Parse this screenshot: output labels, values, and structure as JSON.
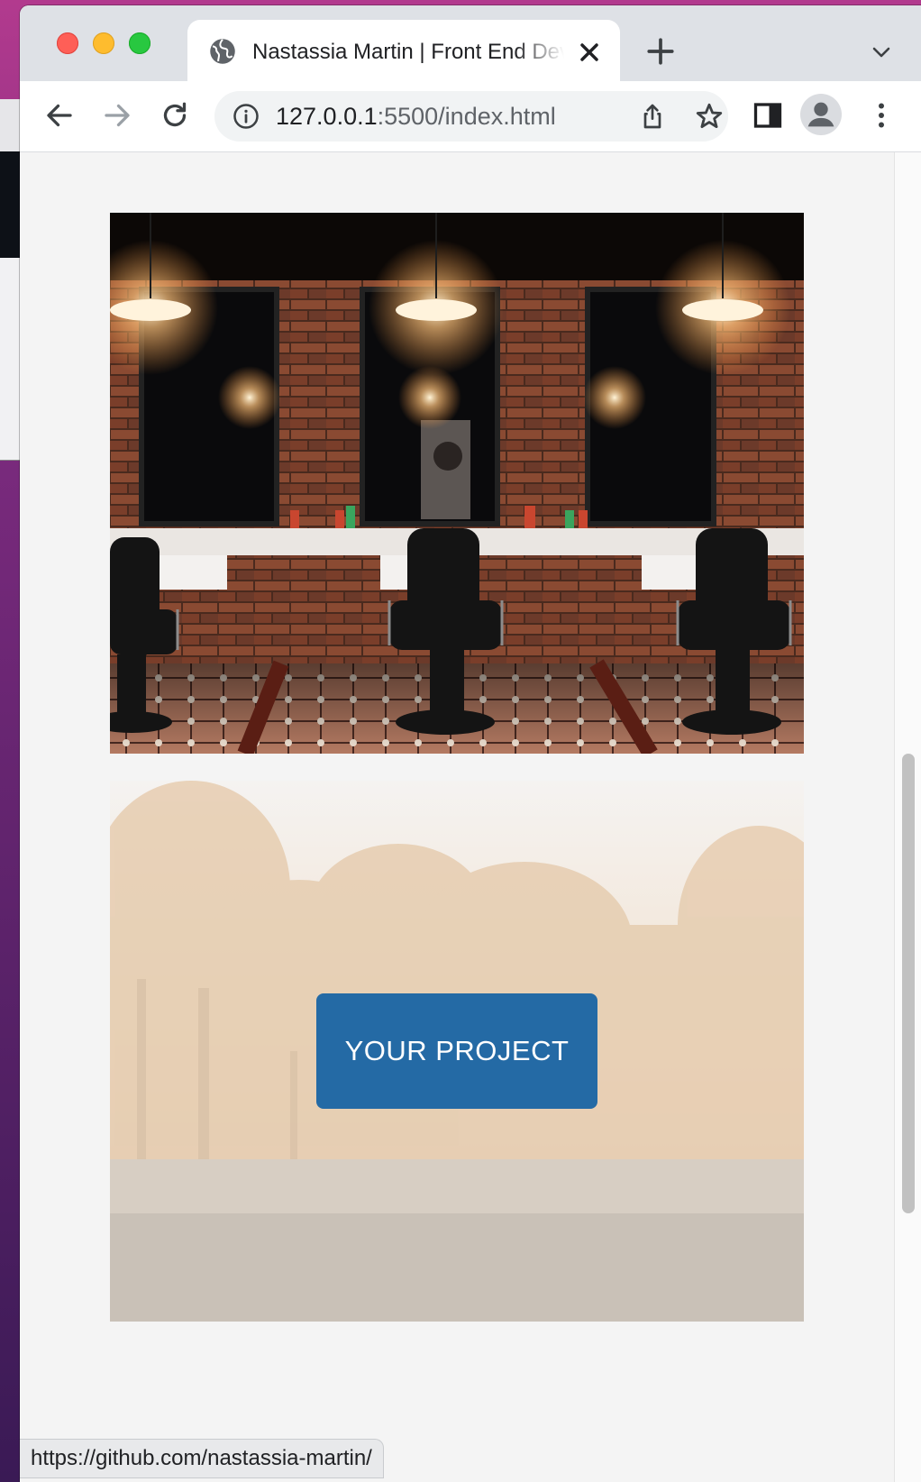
{
  "browser": {
    "tab_title": "Nastassia Martin | Front End Developer",
    "url_host": "127.0.0.1",
    "url_rest": ":5500/index.html"
  },
  "icons": {
    "tab": "globe-icon",
    "tab_close": "close-icon",
    "new_tab": "plus-icon",
    "tab_search": "chevron-down-icon",
    "nav": [
      "back-arrow-icon",
      "forward-arrow-icon",
      "reload-icon"
    ],
    "omnibox": [
      "info-icon",
      "share-icon",
      "star-icon"
    ],
    "toolbar": [
      "side-panel-icon",
      "profile-icon",
      "more-vertical-icon"
    ]
  },
  "page": {
    "project_button_label": "YOUR PROJECT",
    "button_color": "#246aa5"
  },
  "status_bar": {
    "url": "https://github.com/nastassia-martin/"
  }
}
